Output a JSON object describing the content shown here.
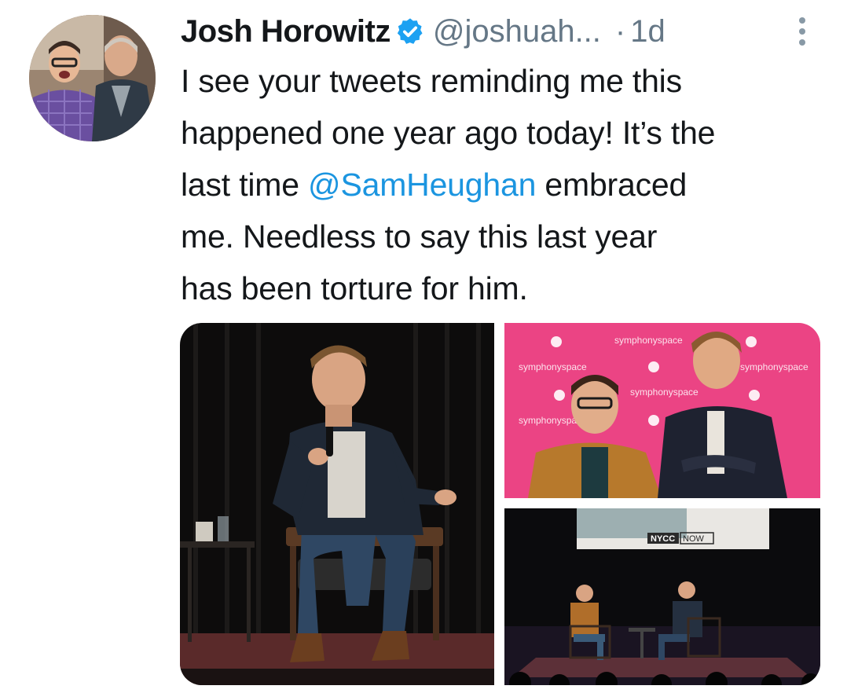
{
  "tweet": {
    "author": {
      "display_name": "Josh Horowitz",
      "handle": "@joshuah...",
      "verified": true,
      "verified_icon": "verified-badge-icon"
    },
    "separator": "·",
    "timestamp": "1d",
    "more_icon": "more-vertical-icon",
    "text_lines": [
      "I see your tweets reminding me this",
      "happened one year ago today! It’s the",
      "last time ",
      " embraced",
      "me. Needless to say this last year",
      "has been torture for him."
    ],
    "mention": "@SamHeughan",
    "colors": {
      "text": "#14171a",
      "secondary": "#657786",
      "link": "#1b95e0",
      "verified": "#1da1f2"
    }
  },
  "media": {
    "photos": [
      {
        "description": "stage"
      },
      {
        "backdrop_text": "symphonyspace"
      },
      {
        "screen_text_1": "NYCC",
        "screen_text_2": "NOW"
      }
    ]
  }
}
